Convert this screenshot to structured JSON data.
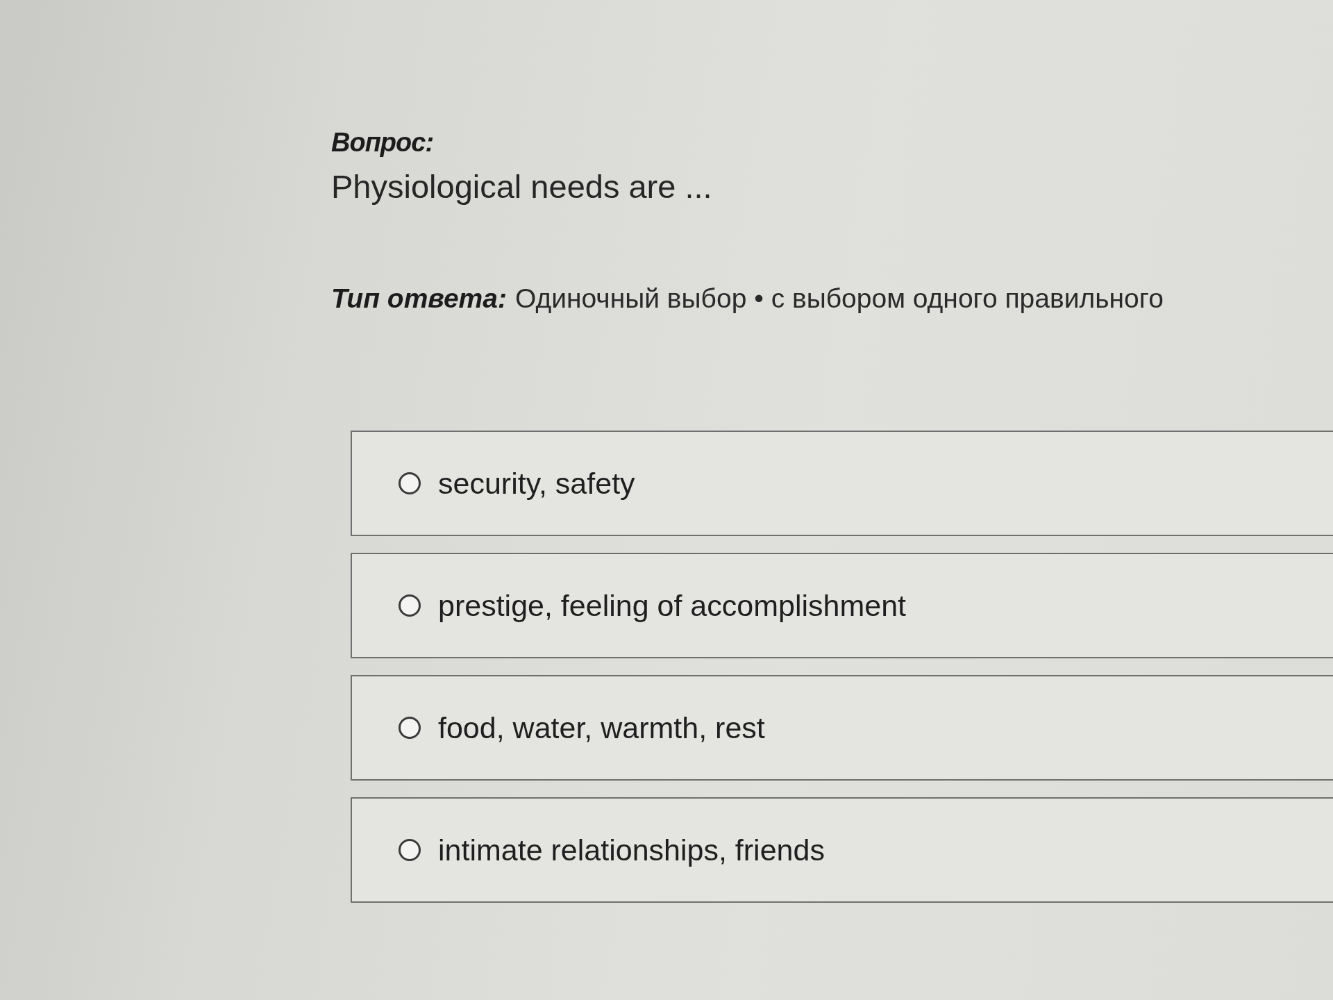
{
  "question": {
    "heading": "Вопрос:",
    "text": "Physiological needs are ..."
  },
  "answer_type": {
    "label": "Тип ответа:",
    "value": "Одиночный выбор • с выбором одного правильного"
  },
  "options": [
    {
      "label": "security, safety",
      "selected": false
    },
    {
      "label": "prestige, feeling of accomplishment",
      "selected": false
    },
    {
      "label": "food, water, warmth, rest",
      "selected": false
    },
    {
      "label": "intimate relationships, friends",
      "selected": false
    }
  ]
}
